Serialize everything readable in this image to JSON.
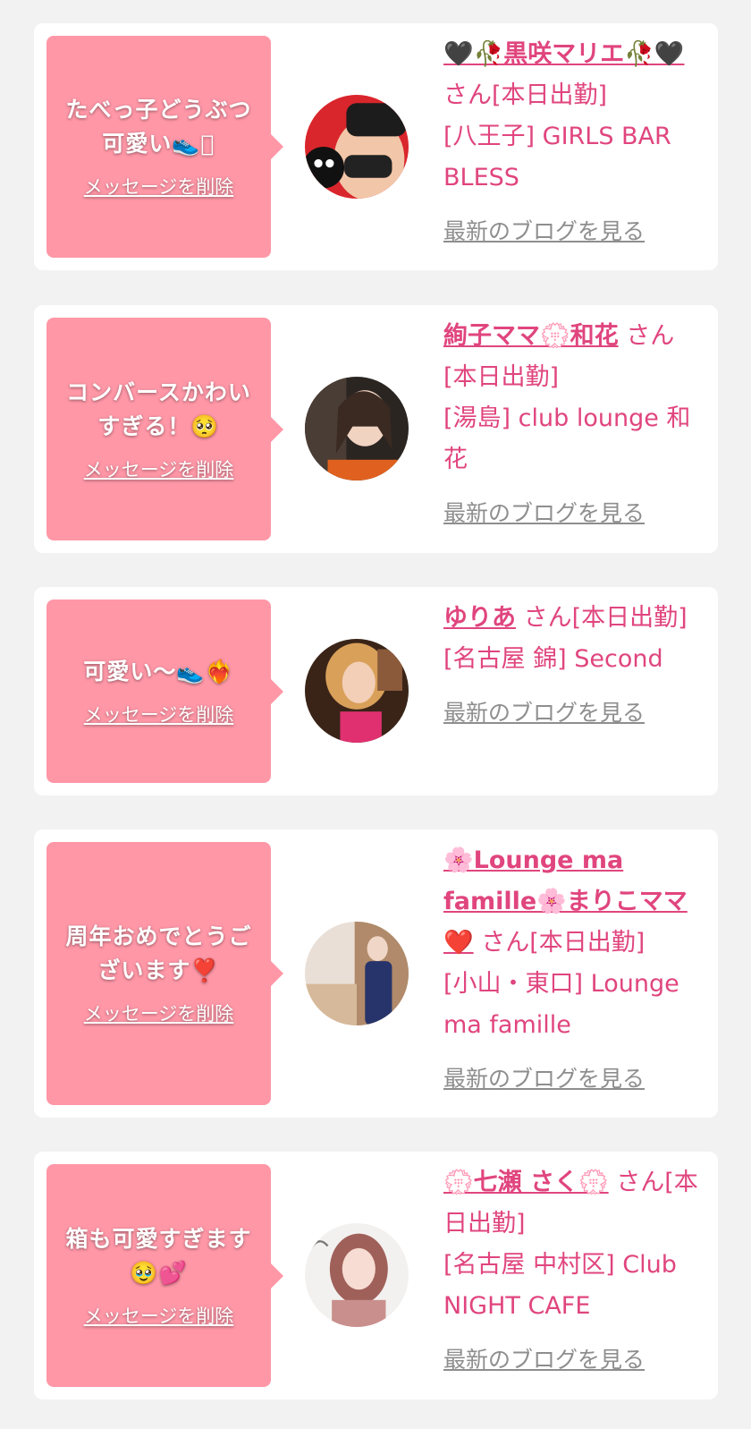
{
  "cards": [
    {
      "message": "たべっ子どうぶつ可愛い👟􏿮",
      "delete_label": "メッセージを削除",
      "name": "🖤🥀黒咲マリエ🥀🖤",
      "name_suffix": " さん[本日出勤]",
      "shop": "[八王子] GIRLS BAR BLESS",
      "blog_label": "最新のブログを見る",
      "avatar_colors": [
        "#d9262c",
        "#1c1c1c"
      ]
    },
    {
      "message": "コンバースかわいすぎる！🥺",
      "delete_label": "メッセージを削除",
      "name": "絢子ママ💮和花",
      "name_suffix": " さん[本日出勤]",
      "shop": "[湯島] club lounge 和花",
      "blog_label": "最新のブログを見る",
      "avatar_colors": [
        "#2b2522",
        "#e0611f"
      ]
    },
    {
      "message": "可愛い〜👟❤️‍🔥",
      "delete_label": "メッセージを削除",
      "name": "ゆりあ",
      "name_suffix": " さん[本日出勤]",
      "shop": "[名古屋 錦] Second",
      "blog_label": "最新のブログを見る",
      "avatar_colors": [
        "#3a2418",
        "#e03070"
      ]
    },
    {
      "message": "周年おめでとうございます❣️",
      "delete_label": "メッセージを削除",
      "name": "🌸Lounge ma famille🌸まりこママ❤️",
      "name_suffix": " さん[本日出勤]",
      "shop": "[小山・東口] Lounge ma famille",
      "blog_label": "最新のブログを見る",
      "avatar_colors": [
        "#e9dfd6",
        "#27346b"
      ]
    },
    {
      "message": "箱も可愛すぎます🥹💕",
      "delete_label": "メッセージを削除",
      "name": "💮七瀬 さく💮",
      "name_suffix": " さん[本日出勤]",
      "shop": "[名古屋 中村区] Club NIGHT CAFE",
      "blog_label": "最新のブログを見る",
      "avatar_colors": [
        "#f3f1f0",
        "#a0605a"
      ]
    }
  ]
}
